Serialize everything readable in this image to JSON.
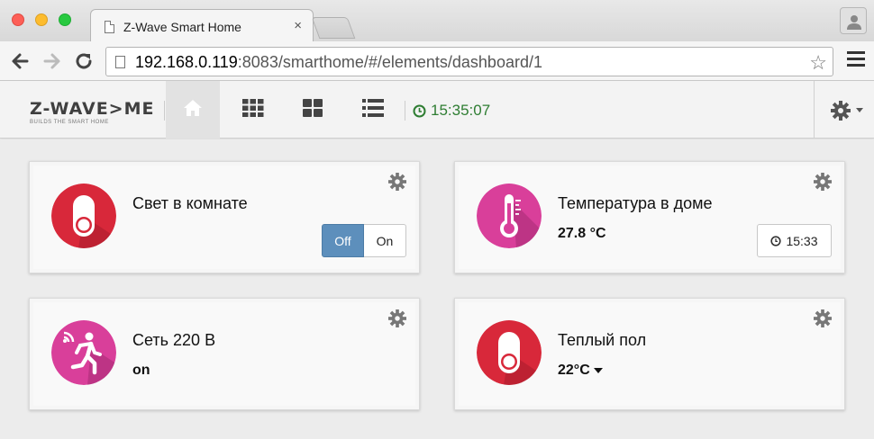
{
  "browser": {
    "tab_title": "Z-Wave Smart Home",
    "tab_close": "×",
    "url_host": "192.168.0.119",
    "url_rest": ":8083/smarthome/#/elements/dashboard/1",
    "star": "☆"
  },
  "app": {
    "brand_name": "Z-WAVE>ME",
    "brand_sub": "BUILDS THE SMART HOME",
    "clock": "15:35:07",
    "nav": [
      {
        "name": "home",
        "active": true
      },
      {
        "name": "elements-grid",
        "active": false
      },
      {
        "name": "dashboard-tiles",
        "active": false
      },
      {
        "name": "list-view",
        "active": false
      }
    ]
  },
  "cards": [
    {
      "title": "Свет в комнате",
      "icon": "switch-icon",
      "icon_color": "#d8283a",
      "toggle": {
        "off_label": "Off",
        "on_label": "On",
        "selected": "Off"
      }
    },
    {
      "title": "Температура в доме",
      "icon": "thermometer-icon",
      "icon_color": "#d93f9a",
      "value": "27.8 °C",
      "time": "15:33"
    },
    {
      "title": "Сеть 220 В",
      "icon": "motion-sensor-icon",
      "icon_color": "#d93f9a",
      "value": "on"
    },
    {
      "title": "Теплый пол",
      "icon": "switch-icon",
      "icon_color": "#d8283a",
      "value": "22°C"
    }
  ],
  "colors": {
    "accent_blue": "#5d8fbc",
    "clock_green": "#2e7d32",
    "red": "#d8283a",
    "pink": "#d93f9a"
  }
}
